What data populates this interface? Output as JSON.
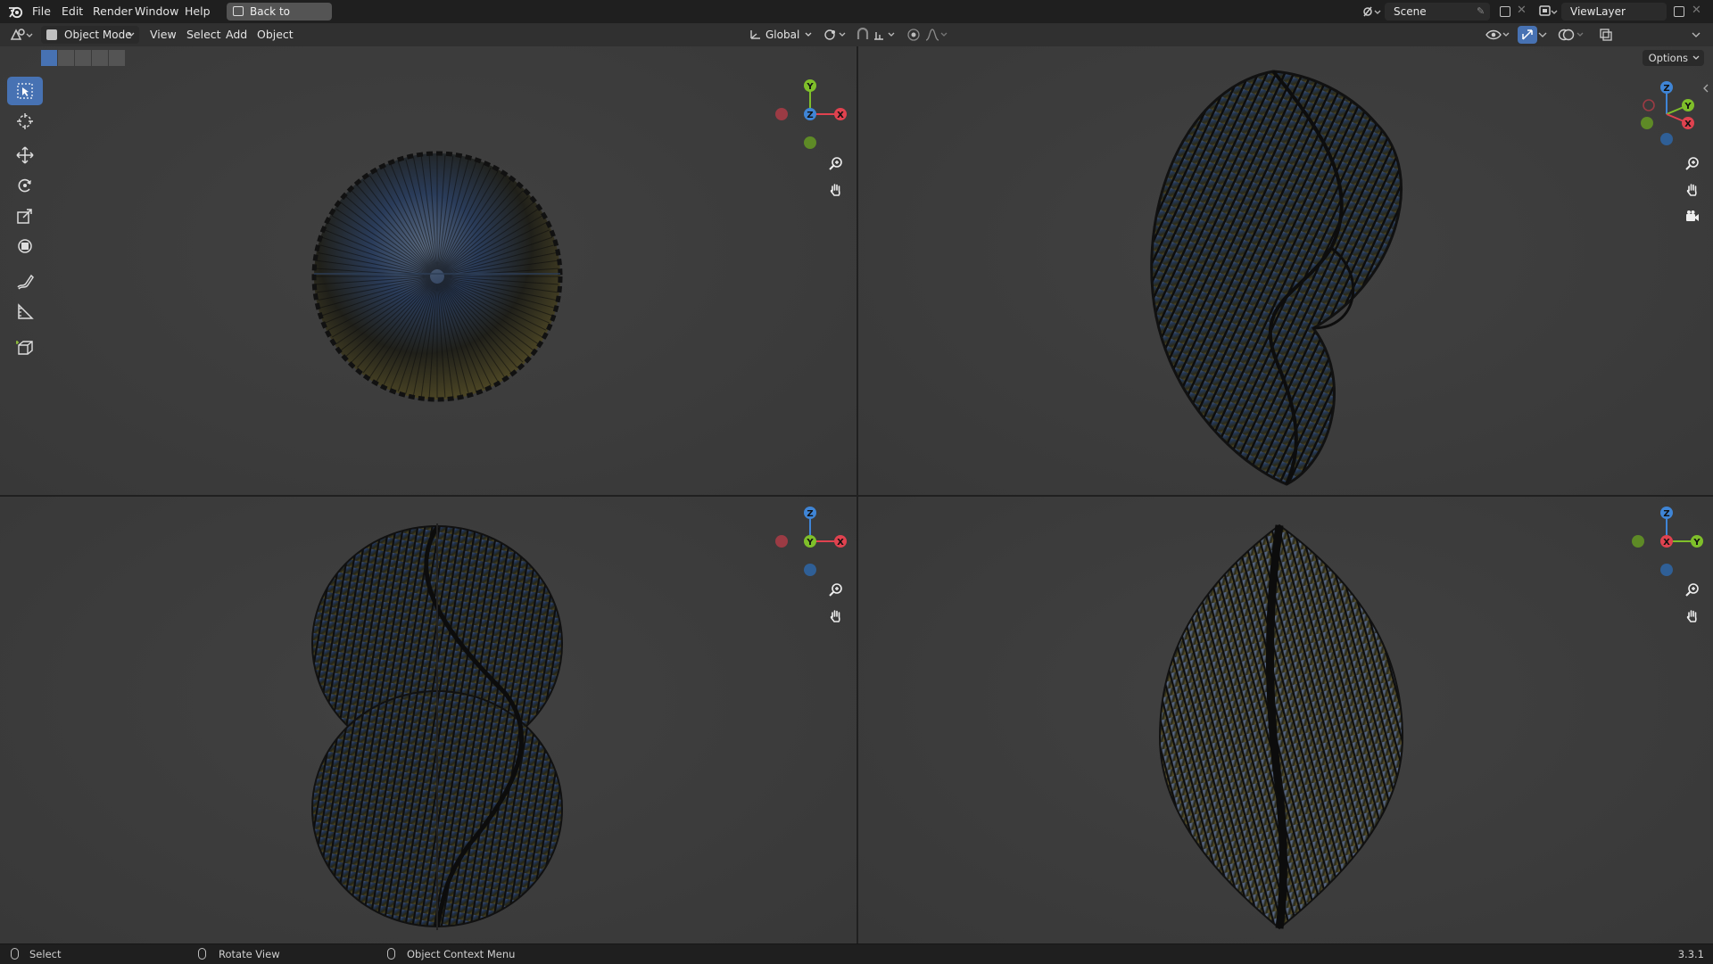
{
  "topbar": {
    "menus": [
      "File",
      "Edit",
      "Render",
      "Window",
      "Help"
    ],
    "back_button": "Back to Previous",
    "scene_name": "Scene",
    "view_layer": "ViewLayer"
  },
  "header": {
    "mode": "Object Mode",
    "menus": [
      "View",
      "Select",
      "Add",
      "Object"
    ],
    "orientation": "Global",
    "options_label": "Options"
  },
  "toolbar": {
    "tools": [
      "select-box",
      "cursor",
      "move",
      "rotate",
      "scale",
      "transform",
      "annotate",
      "measure",
      "add-cube"
    ],
    "active_tool": "select-box"
  },
  "viewports": [
    {
      "name": "top",
      "gizmo_center": "Z",
      "axes_shown": [
        "X",
        "Y",
        "Z"
      ]
    },
    {
      "name": "user-perspective",
      "gizmo_center": "",
      "axes_shown": [
        "X",
        "Y",
        "Z"
      ]
    },
    {
      "name": "front",
      "gizmo_center": "Y",
      "axes_shown": [
        "X",
        "Y",
        "Z"
      ]
    },
    {
      "name": "right",
      "gizmo_center": "X",
      "axes_shown": [
        "X",
        "Y",
        "Z"
      ]
    }
  ],
  "axis_colors": {
    "x": "#e0424f",
    "y": "#7fbf2a",
    "z": "#3f85d6"
  },
  "statusbar": {
    "select": "Select",
    "rotate_view": "Rotate View",
    "context_menu": "Object Context Menu",
    "version": "3.3.1"
  }
}
